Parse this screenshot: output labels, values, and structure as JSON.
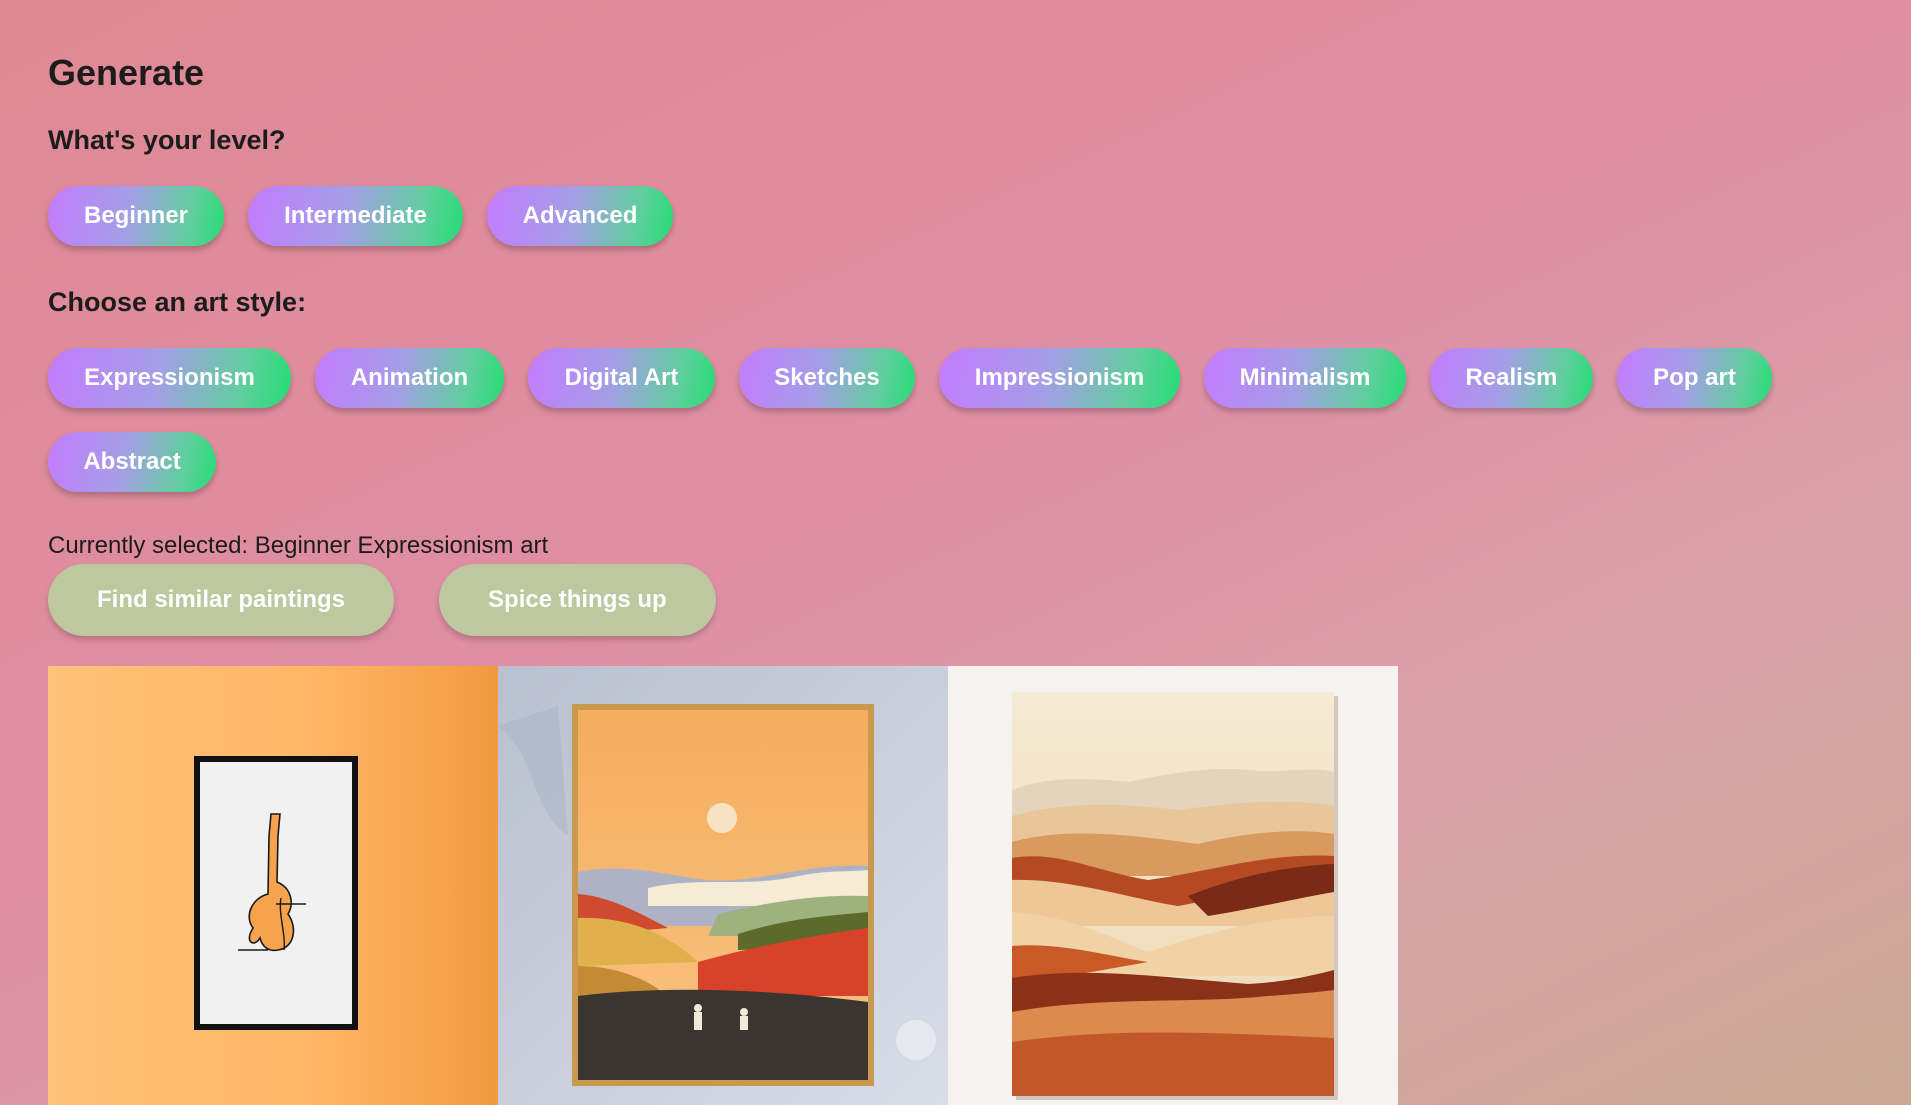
{
  "page": {
    "title": "Generate"
  },
  "level": {
    "label": "What's your level?",
    "options": [
      "Beginner",
      "Intermediate",
      "Advanced"
    ]
  },
  "style": {
    "label": "Choose an art style:",
    "options": [
      "Expressionism",
      "Animation",
      "Digital Art",
      "Sketches",
      "Impressionism",
      "Minimalism",
      "Realism",
      "Pop art",
      "Abstract"
    ]
  },
  "selection": {
    "status": "Currently selected: Beginner Expressionism art"
  },
  "actions": {
    "find_similar": "Find similar paintings",
    "spice": "Spice things up"
  },
  "gallery": {
    "items": [
      {
        "icon": "guitar-line-art-painting"
      },
      {
        "icon": "sunset-hills-painting"
      },
      {
        "icon": "desert-dunes-painting"
      }
    ]
  },
  "colors": {
    "pill_start": "#c37bff",
    "pill_end": "#24dd74",
    "action_button": "#bdc89e",
    "background_start": "#df8993",
    "background_end": "#c9a894"
  }
}
